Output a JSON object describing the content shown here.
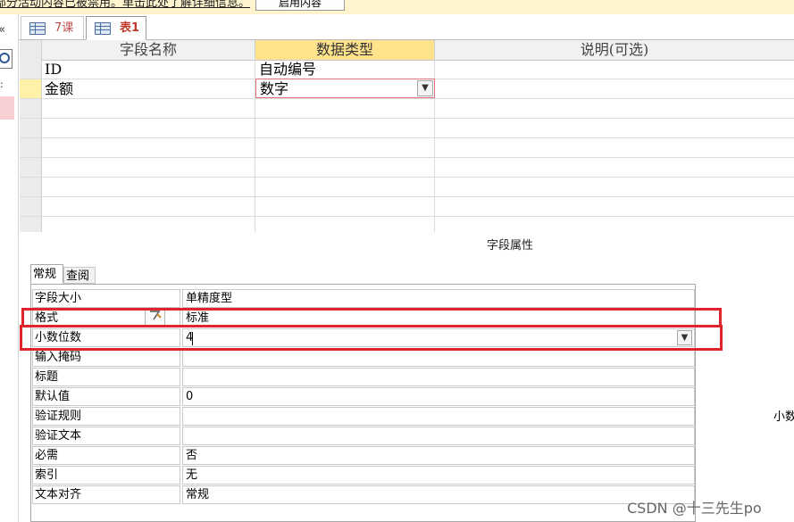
{
  "message_bar": {
    "text": "部分活动内容已被禁用。单击此处了解详细信息。",
    "enable_button": "启用内容"
  },
  "nav_pane": {
    "close_glyph": "«",
    "search_icon": "search-icon"
  },
  "tabs": [
    {
      "label": "7课",
      "icon": "table-icon",
      "active": false
    },
    {
      "label": "表1",
      "icon": "table-icon",
      "active": true
    }
  ],
  "design_grid": {
    "columns": {
      "field_name": "字段名称",
      "data_type": "数据类型",
      "description": "说明(可选)"
    },
    "rows": [
      {
        "field_name": "ID",
        "data_type": "自动编号",
        "description": ""
      },
      {
        "field_name": "金额",
        "data_type": "数字",
        "description": "",
        "current": true
      }
    ]
  },
  "properties": {
    "section_title": "字段属性",
    "tabs": [
      "常规",
      "查阅"
    ],
    "active_tab": "常规",
    "rows": [
      {
        "label": "字段大小",
        "value": "单精度型"
      },
      {
        "label": "格式",
        "value": "标准"
      },
      {
        "label": "小数位数",
        "value": "4"
      },
      {
        "label": "输入掩码",
        "value": ""
      },
      {
        "label": "标题",
        "value": ""
      },
      {
        "label": "默认值",
        "value": "0"
      },
      {
        "label": "验证规则",
        "value": ""
      },
      {
        "label": "验证文本",
        "value": ""
      },
      {
        "label": "必需",
        "value": "否"
      },
      {
        "label": "索引",
        "value": "无"
      },
      {
        "label": "文本对齐",
        "value": "常规"
      }
    ]
  },
  "side_hint": "小数",
  "highlight_color": "#e0242b",
  "watermark": "CSDN @十三先生po"
}
